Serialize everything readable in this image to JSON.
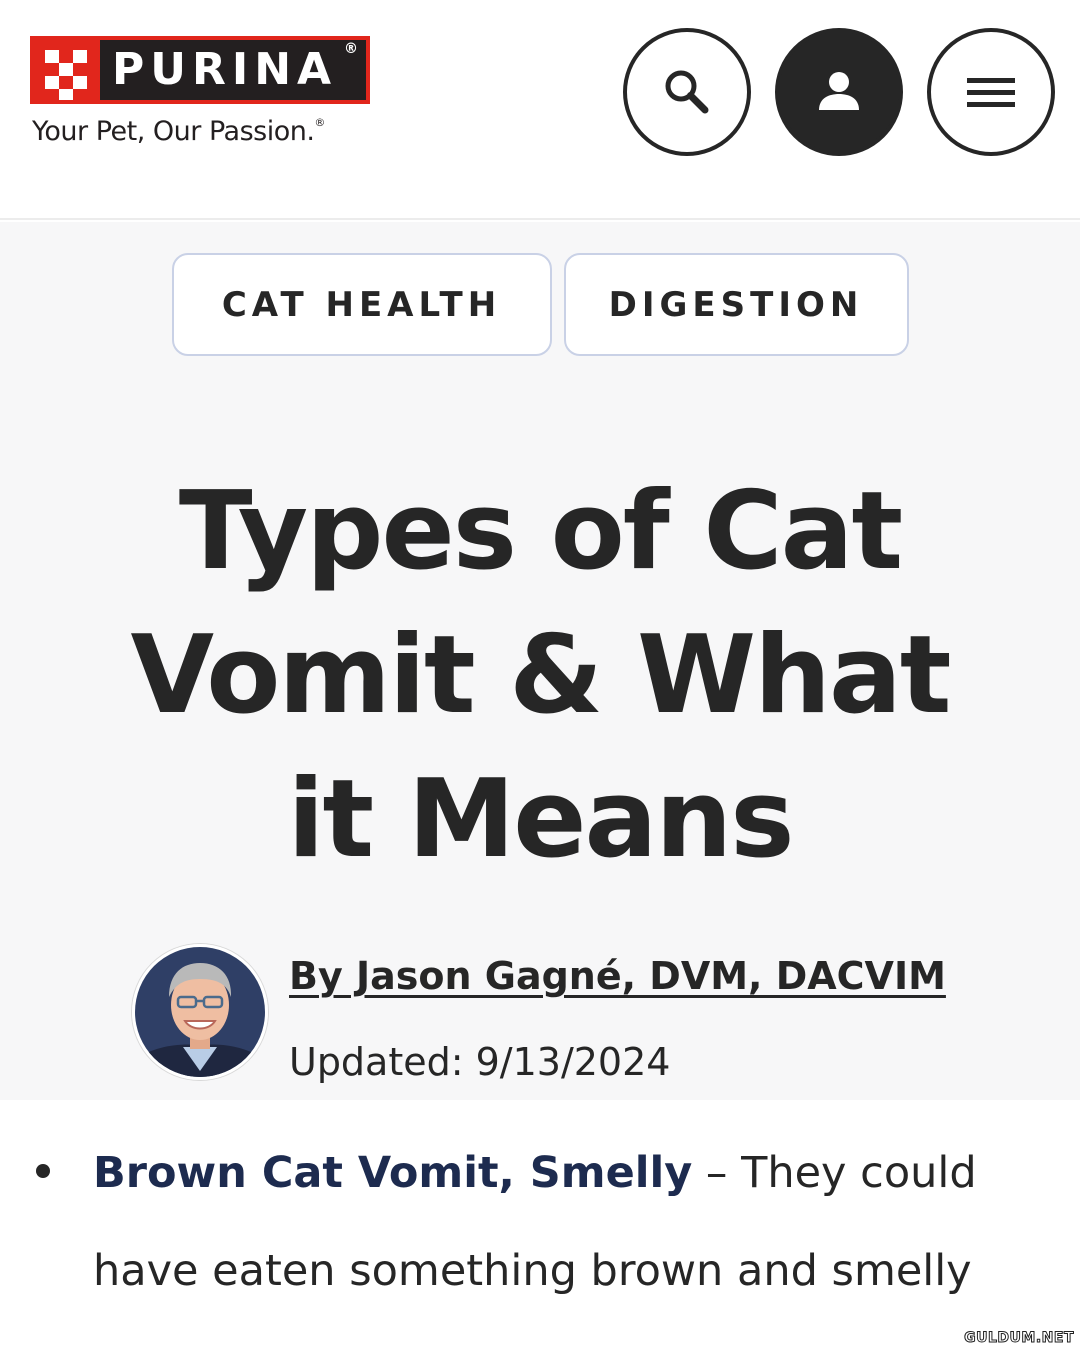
{
  "header": {
    "logo": {
      "wordmark": "PURINA",
      "reg_mark": "®"
    },
    "tagline": "Your Pet, Our Passion.",
    "tagline_mark": "®",
    "buttons": [
      {
        "name": "search",
        "icon": "search-icon"
      },
      {
        "name": "account",
        "icon": "user-icon"
      },
      {
        "name": "menu",
        "icon": "hamburger-menu-icon"
      }
    ]
  },
  "article": {
    "tags": [
      "CAT HEALTH",
      "DIGESTION"
    ],
    "title": "Types of Cat Vomit & What it Means",
    "author": {
      "byline": "By Jason Gagné, DVM, DACVIM",
      "updated": "Updated: 9/13/2024"
    },
    "list": [
      {
        "heading": "Brown Cat Vomit, Smelly",
        "text": " – They could have eaten something brown and smelly"
      }
    ]
  },
  "watermark": "GULDUM.NET",
  "colors": {
    "brand_red": "#e1261c",
    "brand_dark": "#231f20",
    "text": "#262626",
    "link_strong": "#1d2b4f",
    "hero_bg": "#f7f7f8",
    "tag_border": "#c9d1e6"
  }
}
